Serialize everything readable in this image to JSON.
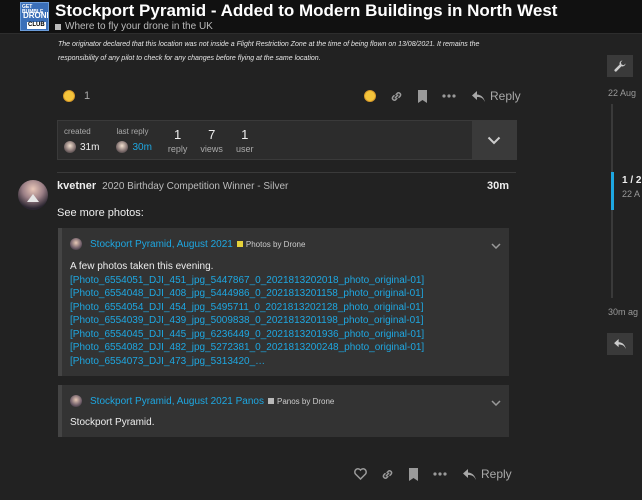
{
  "header": {
    "logo_lines": [
      "GET BUMBLE",
      "DRONE",
      "CLUB"
    ],
    "title": "Stockport Pyramid - Added to Modern Buildings in North West",
    "category": "Where to fly your drone in the UK"
  },
  "post1": {
    "text": "The originator declared that this location was not inside a Flight Restriction Zone at the time of being flown on 13/08/2021. It remains the responsibility of any pilot to check for any changes before flying at the same location.",
    "reaction_count": "1",
    "reply_label": "Reply"
  },
  "topic_map": {
    "created_label": "created",
    "created_value": "31m",
    "last_reply_label": "last reply",
    "last_reply_value": "30m",
    "replies_count": "1",
    "replies_label": "reply",
    "views_count": "7",
    "views_label": "views",
    "users_count": "1",
    "users_label": "user"
  },
  "post2": {
    "username": "kvetner",
    "user_title": "2020 Birthday Competition Winner - Silver",
    "time": "30m",
    "body": "See more photos:",
    "reply_label": "Reply",
    "onebox1": {
      "title": "Stockport Pyramid, August 2021",
      "category": "Photos by Drone",
      "category_color": "#e6d23a",
      "intro": "A few photos taken this evening.",
      "links": [
        "[Photo_6554051_DJI_451_jpg_5447867_0_2021813202018_photo_original-01]",
        "[Photo_6554048_DJI_408_jpg_5444986_0_2021813201158_photo_original-01]",
        "[Photo_6554054_DJI_454_jpg_5495711_0_2021813202128_photo_original-01]",
        "[Photo_6554039_DJI_439_jpg_5009838_0_2021813201198_photo_original-01]",
        "[Photo_6554045_DJI_445_jpg_6236449_0_2021813201936_photo_original-01]",
        "[Photo_6554082_DJI_482_jpg_5272381_0_2021813200248_photo_original-01]",
        "[Photo_6554073_DJI_473_jpg_5313420_…"
      ]
    },
    "onebox2": {
      "title": "Stockport Pyramid, August 2021 Panos",
      "category": "Panos by Drone",
      "category_color": "#b9b9b9",
      "text": "Stockport Pyramid."
    }
  },
  "timeline": {
    "top_date": "22 Aug",
    "fraction": "1 / 2",
    "current_date": "22 A",
    "bottom_date": "30m ag"
  },
  "colors": {
    "accent": "#1ea7e1",
    "background": "#222222",
    "header": "#111111"
  }
}
